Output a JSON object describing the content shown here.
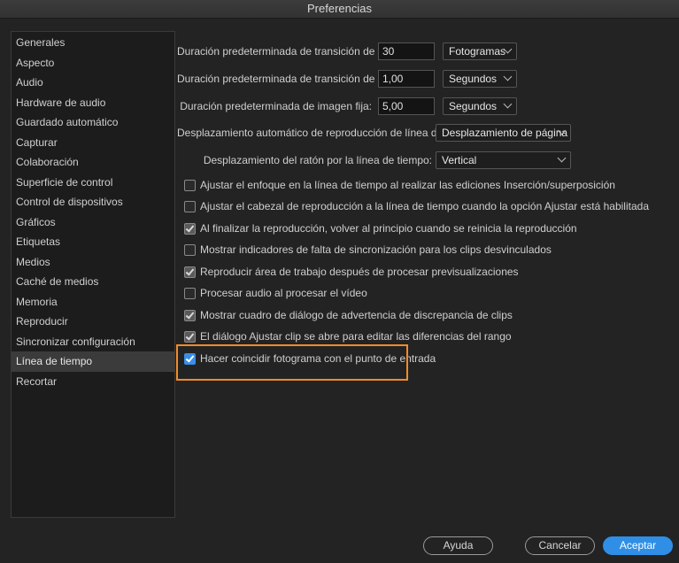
{
  "window": {
    "title": "Preferencias"
  },
  "sidebar": {
    "items": [
      {
        "label": "Generales"
      },
      {
        "label": "Aspecto"
      },
      {
        "label": "Audio"
      },
      {
        "label": "Hardware de audio"
      },
      {
        "label": "Guardado automático"
      },
      {
        "label": "Capturar"
      },
      {
        "label": "Colaboración"
      },
      {
        "label": "Superficie de control"
      },
      {
        "label": "Control de dispositivos"
      },
      {
        "label": "Gráficos"
      },
      {
        "label": "Etiquetas"
      },
      {
        "label": "Medios"
      },
      {
        "label": "Caché de medios"
      },
      {
        "label": "Memoria"
      },
      {
        "label": "Reproducir"
      },
      {
        "label": "Sincronizar configuración"
      },
      {
        "label": "Línea de tiempo",
        "selected": true
      },
      {
        "label": "Recortar"
      }
    ]
  },
  "settings": {
    "video_transition": {
      "label": "Duración predeterminada de transición de vídeo:",
      "value": "30",
      "unit": "Fotogramas"
    },
    "audio_transition": {
      "label": "Duración predeterminada de transición de audio:",
      "value": "1,00",
      "unit": "Segundos"
    },
    "still_image": {
      "label": "Duración predeterminada de imagen fija:",
      "value": "5,00",
      "unit": "Segundos"
    },
    "playback_autoscroll": {
      "label": "Desplazamiento automático de reproducción de línea de tiempo:",
      "value": "Desplazamiento de página"
    },
    "mouse_scroll": {
      "label": "Desplazamiento del ratón por la línea de tiempo:",
      "value": "Vertical"
    }
  },
  "checkboxes": [
    {
      "label": "Ajustar el enfoque en la línea de tiempo al realizar las ediciones Inserción/superposición",
      "checked": false
    },
    {
      "label": "Ajustar el cabezal de reproducción a la línea de tiempo cuando la opción Ajustar está habilitada",
      "checked": false
    },
    {
      "label": "Al finalizar la reproducción, volver al principio cuando se reinicia la reproducción",
      "checked": true
    },
    {
      "label": "Mostrar indicadores de falta de sincronización para los clips desvinculados",
      "checked": false
    },
    {
      "label": "Reproducir área de trabajo después de procesar previsualizaciones",
      "checked": true
    },
    {
      "label": "Procesar audio al procesar el vídeo",
      "checked": false
    },
    {
      "label": "Mostrar cuadro de diálogo de advertencia de discrepancia de clips",
      "checked": true
    },
    {
      "label": "El diálogo Ajustar clip se abre para editar las diferencias del rango",
      "checked": true
    },
    {
      "label": "Hacer coincidir fotograma con el punto de entrada",
      "checked": true
    }
  ],
  "buttons": {
    "help": "Ayuda",
    "cancel": "Cancelar",
    "ok": "Aceptar"
  },
  "colors": {
    "accent": "#2f8fe7",
    "highlight": "#f28c28",
    "background": "#232323"
  }
}
